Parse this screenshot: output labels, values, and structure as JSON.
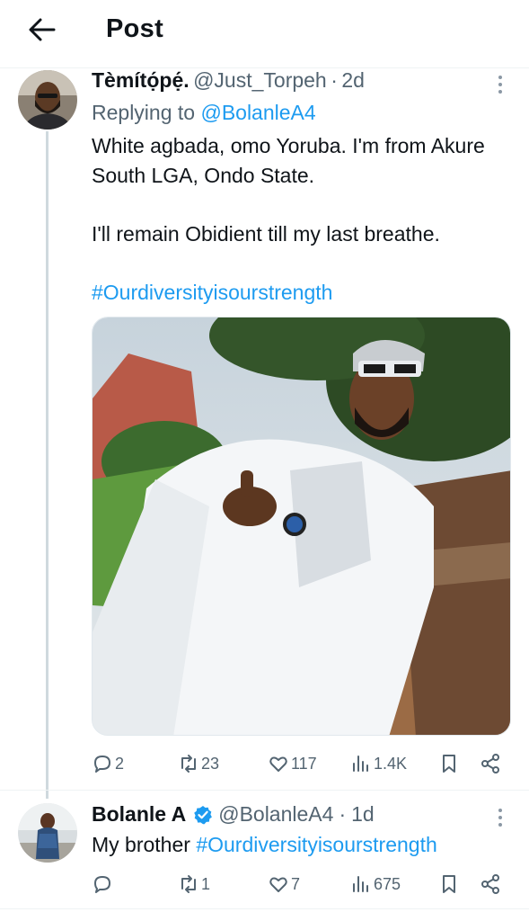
{
  "header": {
    "title": "Post"
  },
  "tweet1": {
    "display_name": "Tèmítọ́pẹ́.",
    "handle": "@Just_Torpeh",
    "separator": "·",
    "time": "2d",
    "replying_prefix": "Replying to",
    "replying_to": "@BolanleA4",
    "line1": "White agbada, omo Yoruba. I'm from Akure South LGA, Ondo State.",
    "line2": "I'll remain Obidient till my last breathe.",
    "hashtag": "#Ourdiversityisourstrength",
    "stats": {
      "replies": "2",
      "reposts": "23",
      "likes": "117",
      "views": "1.4K"
    }
  },
  "tweet2": {
    "display_name": "Bolanle A",
    "handle": "@BolanleA4",
    "separator": "·",
    "time": "1d",
    "text_prefix": "My brother",
    "hashtag": "#Ourdiversityisourstrength",
    "stats": {
      "replies": "",
      "reposts": "1",
      "likes": "7",
      "views": "675"
    }
  },
  "colors": {
    "text": "#0f1419",
    "secondary": "#536471",
    "link": "#1d9bf0",
    "thread_line": "#cfd9de",
    "verified": "#1d9bf0"
  },
  "icons": [
    "back-arrow-icon",
    "more-icon",
    "reply-icon",
    "repost-icon",
    "like-icon",
    "views-icon",
    "bookmark-icon",
    "share-icon",
    "verified-badge-icon"
  ]
}
